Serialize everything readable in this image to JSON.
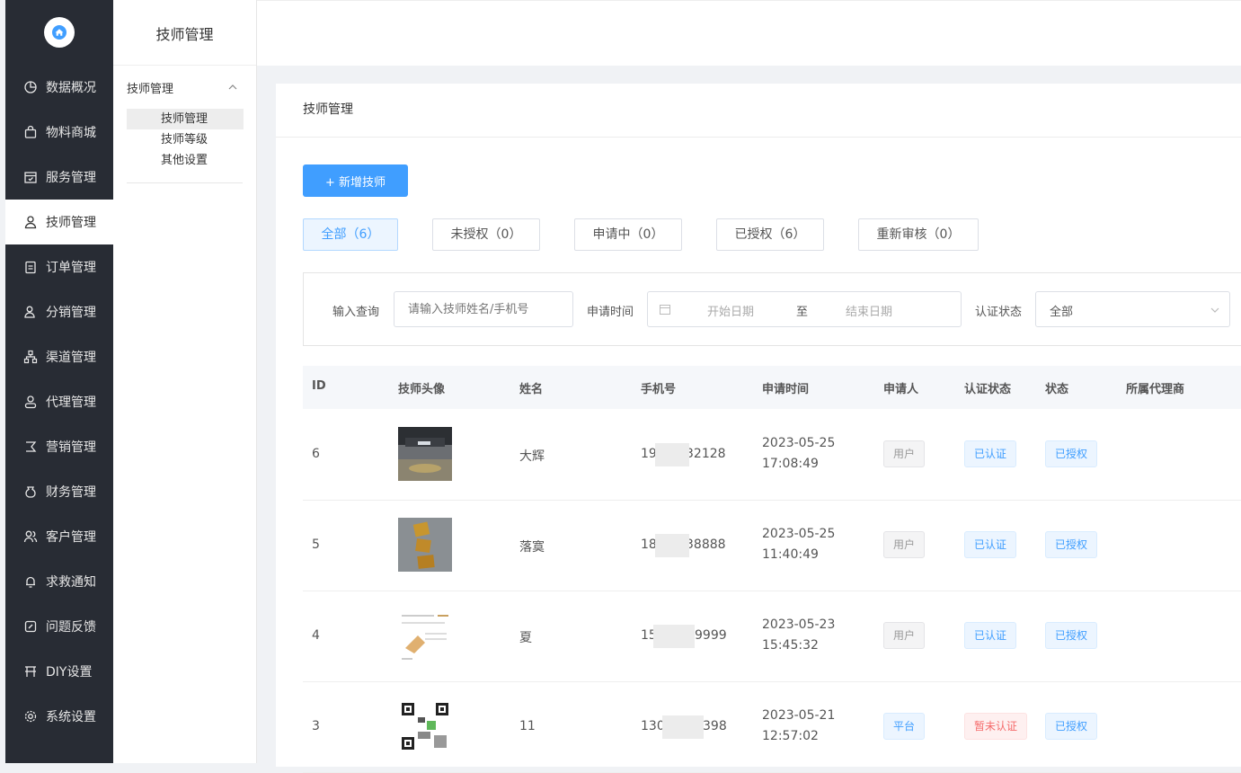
{
  "sidebar": {
    "items": [
      {
        "label": "数据概况",
        "icon": "pie-chart-icon"
      },
      {
        "label": "物料商城",
        "icon": "shopping-bag-icon"
      },
      {
        "label": "服务管理",
        "icon": "calendar-check-icon"
      },
      {
        "label": "技师管理",
        "icon": "user-icon",
        "active": true
      },
      {
        "label": "订单管理",
        "icon": "clipboard-icon"
      },
      {
        "label": "分销管理",
        "icon": "user-share-icon"
      },
      {
        "label": "渠道管理",
        "icon": "network-icon"
      },
      {
        "label": "代理管理",
        "icon": "agent-icon"
      },
      {
        "label": "营销管理",
        "icon": "marketing-icon"
      },
      {
        "label": "财务管理",
        "icon": "money-bag-icon"
      },
      {
        "label": "客户管理",
        "icon": "users-icon"
      },
      {
        "label": "求救通知",
        "icon": "bell-icon"
      },
      {
        "label": "问题反馈",
        "icon": "feedback-icon"
      },
      {
        "label": "DIY设置",
        "icon": "diy-icon"
      },
      {
        "label": "系统设置",
        "icon": "gear-icon"
      }
    ]
  },
  "subside": {
    "title": "技师管理",
    "group_label": "技师管理",
    "items": [
      {
        "label": "技师管理",
        "active": true
      },
      {
        "label": "技师等级"
      },
      {
        "label": "其他设置"
      }
    ]
  },
  "panel": {
    "title": "技师管理",
    "add_button": "+ 新增技师",
    "tabs": [
      {
        "label": "全部（6）",
        "active": true
      },
      {
        "label": "未授权（0）"
      },
      {
        "label": "申请中（0）"
      },
      {
        "label": "已授权（6）"
      },
      {
        "label": "重新审核（0）"
      }
    ]
  },
  "filter": {
    "query_label": "输入查询",
    "query_placeholder": "请输入技师姓名/手机号",
    "date_label": "申请时间",
    "start_placeholder": "开始日期",
    "date_sep": "至",
    "end_placeholder": "结束日期",
    "status_label": "认证状态",
    "status_value": "全部"
  },
  "table": {
    "headers": [
      "ID",
      "技师头像",
      "姓名",
      "手机号",
      "申请时间",
      "申请人",
      "认证状态",
      "状态",
      "所属代理商"
    ],
    "rows": [
      {
        "id": "6",
        "name": "大辉",
        "phone_prefix": "19",
        "phone_suffix": "32128",
        "date": "2023-05-25",
        "time": "17:08:49",
        "applicant": "用户",
        "cert": "已认证",
        "status": "已授权",
        "agent": ""
      },
      {
        "id": "5",
        "name": "落寞",
        "phone_prefix": "18",
        "phone_suffix": "38888",
        "date": "2023-05-25",
        "time": "11:40:49",
        "applicant": "用户",
        "cert": "已认证",
        "status": "已授权",
        "agent": ""
      },
      {
        "id": "4",
        "name": "夏",
        "phone_prefix": "15",
        "phone_suffix": "9999",
        "date": "2023-05-23",
        "time": "15:45:32",
        "applicant": "用户",
        "cert": "已认证",
        "status": "已授权",
        "agent": ""
      },
      {
        "id": "3",
        "name": "11",
        "phone_prefix": "130",
        "phone_suffix": "398",
        "date": "2023-05-21",
        "time": "12:57:02",
        "applicant": "平台",
        "cert": "暂未认证",
        "status": "已授权",
        "agent": ""
      }
    ]
  },
  "colors": {
    "sidebar": "#282c34",
    "primary": "#409eff",
    "danger": "#f56c6c"
  }
}
